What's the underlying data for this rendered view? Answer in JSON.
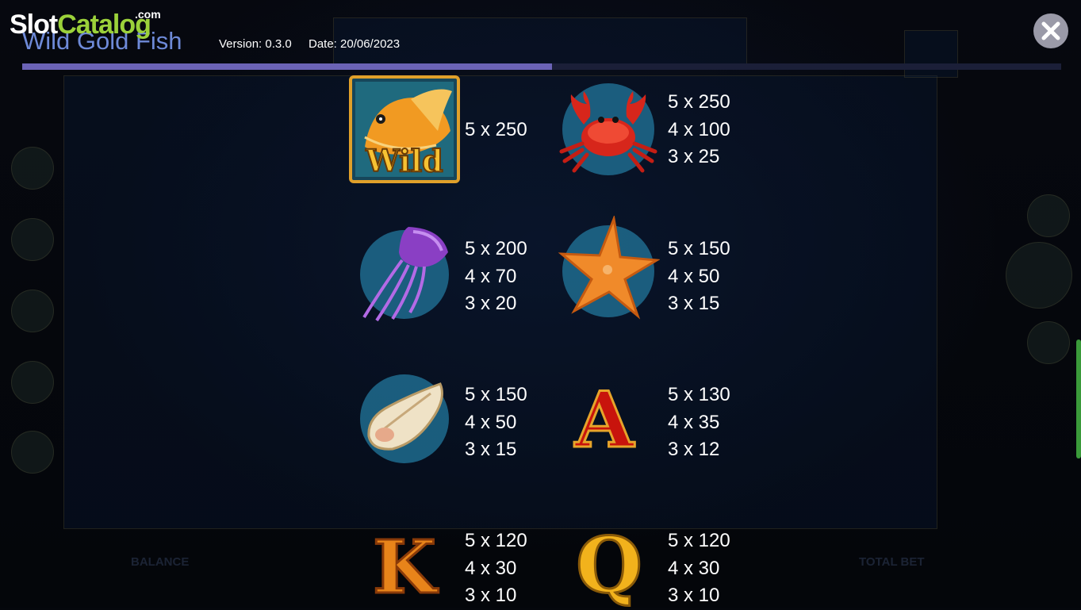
{
  "header": {
    "watermark": {
      "slot": "Slot",
      "catalog": "Catalog",
      "com": ".com"
    },
    "title": "Wild Gold Fish",
    "version": "Version: 0.3.0",
    "date": "Date: 20/06/2023",
    "progress_fraction": 0.51
  },
  "close_button": {
    "icon": "close-icon"
  },
  "paytable": [
    {
      "symbol": "wild-goldfish",
      "label": "Wild",
      "pays": [
        "5 x 250"
      ]
    },
    {
      "symbol": "crab",
      "pays": [
        "5 x 250",
        "4 x 100",
        "3 x 25"
      ]
    },
    {
      "symbol": "jellyfish",
      "pays": [
        "5 x 200",
        "4 x 70",
        "3 x 20"
      ]
    },
    {
      "symbol": "starfish",
      "pays": [
        "5 x 150",
        "4 x 50",
        "3 x 15"
      ]
    },
    {
      "symbol": "seashell",
      "pays": [
        "5 x 150",
        "4 x 50",
        "3 x 15"
      ]
    },
    {
      "symbol": "letter-a",
      "label": "A",
      "pays": [
        "5 x 130",
        "4 x 35",
        "3 x 12"
      ]
    },
    {
      "symbol": "letter-k",
      "label": "K",
      "pays": [
        "5 x 120",
        "4 x 30",
        "3 x 10"
      ]
    },
    {
      "symbol": "letter-q",
      "label": "Q",
      "pays": [
        "5 x 120",
        "4 x 30",
        "3 x 10"
      ]
    }
  ],
  "colors": {
    "title": "#6e8ad8",
    "progress": "#6b63b6",
    "watermark_accent": "#9bd13a",
    "gold": "#e8a419",
    "royal_red": "#c8140c"
  }
}
